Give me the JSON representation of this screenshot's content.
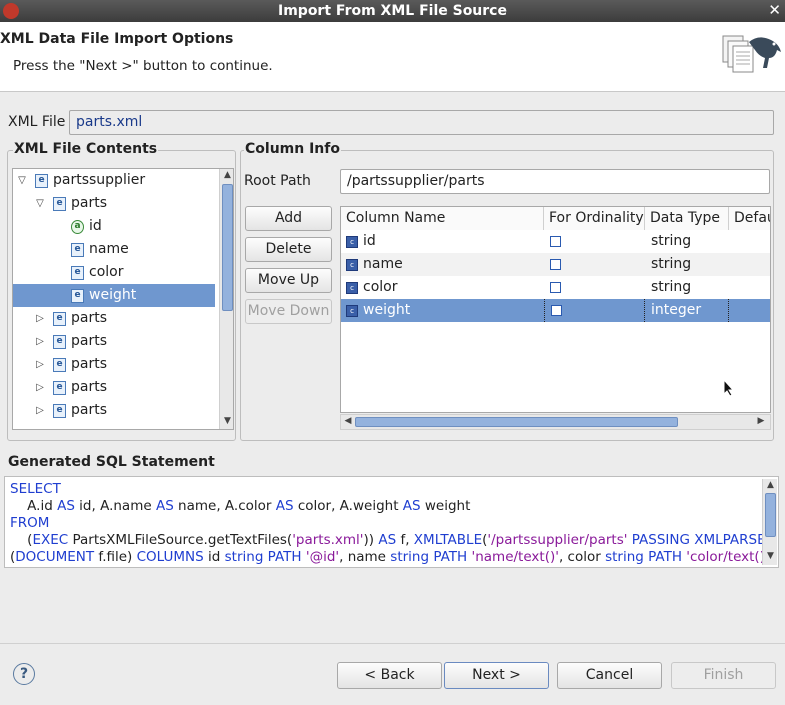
{
  "window": {
    "title": "Import From XML File Source",
    "close": "✕"
  },
  "header": {
    "title": "XML Data File Import Options",
    "description": "Press the \"Next >\" button to continue."
  },
  "xml_file": {
    "label": "XML File",
    "value": "parts.xml"
  },
  "contents": {
    "title": "XML File Contents",
    "tree": [
      {
        "label": "partssupplier",
        "icon": "e",
        "level": 0,
        "twist": "▽"
      },
      {
        "label": "parts",
        "icon": "e",
        "level": 1,
        "twist": "▽"
      },
      {
        "label": "id",
        "icon": "a",
        "level": 2,
        "twist": ""
      },
      {
        "label": "name",
        "icon": "e",
        "level": 2,
        "twist": ""
      },
      {
        "label": "color",
        "icon": "e",
        "level": 2,
        "twist": ""
      },
      {
        "label": "weight",
        "icon": "e",
        "level": 2,
        "twist": "",
        "selected": true
      },
      {
        "label": "parts",
        "icon": "e",
        "level": 1,
        "twist": "▷"
      },
      {
        "label": "parts",
        "icon": "e",
        "level": 1,
        "twist": "▷"
      },
      {
        "label": "parts",
        "icon": "e",
        "level": 1,
        "twist": "▷"
      },
      {
        "label": "parts",
        "icon": "e",
        "level": 1,
        "twist": "▷"
      },
      {
        "label": "parts",
        "icon": "e",
        "level": 1,
        "twist": "▷"
      }
    ]
  },
  "column_info": {
    "title": "Column Info",
    "root_path_label": "Root Path",
    "root_path_value": "/partssupplier/parts",
    "buttons": {
      "add": "Add",
      "delete": "Delete",
      "move_up": "Move Up",
      "move_down": "Move Down"
    },
    "headers": [
      "Column Name",
      "For Ordinality",
      "Data Type",
      "Defau"
    ],
    "rows": [
      {
        "name": "id",
        "type": "string"
      },
      {
        "name": "name",
        "type": "string"
      },
      {
        "name": "color",
        "type": "string"
      },
      {
        "name": "weight",
        "type": "integer",
        "selected": true
      }
    ]
  },
  "sql": {
    "title": "Generated SQL Statement",
    "lines": [
      [
        [
          "kw",
          "SELECT"
        ]
      ],
      [
        [
          "t",
          "    A.id "
        ],
        [
          "kw",
          "AS"
        ],
        [
          "t",
          " id, A.name "
        ],
        [
          "kw",
          "AS"
        ],
        [
          "t",
          " name, A.color "
        ],
        [
          "kw",
          "AS"
        ],
        [
          "t",
          " color, A.weight "
        ],
        [
          "kw",
          "AS"
        ],
        [
          "t",
          " weight"
        ]
      ],
      [
        [
          "kw",
          "FROM"
        ]
      ],
      [
        [
          "t",
          "    ("
        ],
        [
          "kw",
          "EXEC"
        ],
        [
          "t",
          " PartsXMLFileSource.getTextFiles("
        ],
        [
          "str",
          "'parts.xml'"
        ],
        [
          "t",
          ")) "
        ],
        [
          "kw",
          "AS"
        ],
        [
          "t",
          " f, "
        ],
        [
          "kw",
          "XMLTABLE"
        ],
        [
          "t",
          "("
        ],
        [
          "str",
          "'/partssupplier/parts'"
        ],
        [
          "t",
          " "
        ],
        [
          "kw",
          "PASSING XMLPARSE"
        ]
      ],
      [
        [
          "t",
          "("
        ],
        [
          "kw",
          "DOCUMENT"
        ],
        [
          "t",
          " f.file) "
        ],
        [
          "kw",
          "COLUMNS"
        ],
        [
          "t",
          " id "
        ],
        [
          "kw",
          "string PATH"
        ],
        [
          "t",
          " "
        ],
        [
          "str",
          "'@id'"
        ],
        [
          "t",
          ", name "
        ],
        [
          "kw",
          "string PATH"
        ],
        [
          "t",
          " "
        ],
        [
          "str",
          "'name/text()'"
        ],
        [
          "t",
          ", color "
        ],
        [
          "kw",
          "string PATH"
        ],
        [
          "t",
          " "
        ],
        [
          "str",
          "'color/text()'"
        ],
        [
          "t",
          ","
        ]
      ]
    ]
  },
  "footer": {
    "help": "?",
    "back": "< Back",
    "next": "Next >",
    "cancel": "Cancel",
    "finish": "Finish"
  }
}
